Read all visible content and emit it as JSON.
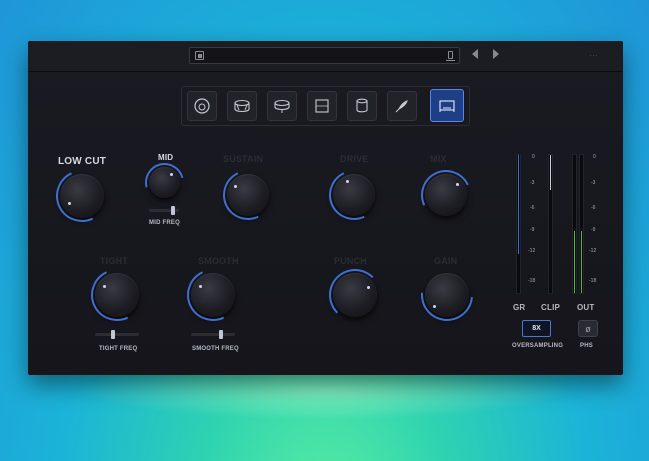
{
  "preset_bar": {
    "preset_name": "",
    "prev_label": "◀",
    "next_label": "▶",
    "menu_label": "···"
  },
  "toolbar": {
    "modes": [
      {
        "icon": "kick-drum-icon",
        "active": false
      },
      {
        "icon": "snare-drum-icon",
        "active": false
      },
      {
        "icon": "tom-drum-icon",
        "active": false
      },
      {
        "icon": "frame-icon",
        "active": false
      },
      {
        "icon": "hand-drum-icon",
        "active": false
      },
      {
        "icon": "feather-icon",
        "active": false
      },
      {
        "icon": "drum-overhead-icon",
        "active": true
      }
    ]
  },
  "controls": {
    "low_cut": "LOW CUT",
    "mid": "MID",
    "mid_freq": "MID FREQ",
    "faded_1": "SUSTAIN",
    "faded_2": "DRIVE",
    "faded_3": "MIX",
    "faded_4": "TIGHT",
    "faded_5": "SMOOTH",
    "faded_6": "PUNCH",
    "faded_7": "GAIN",
    "tight_freq": "TIGHT FREQ",
    "smooth_freq": "SMOOTH FREQ"
  },
  "meters": {
    "scale": [
      "0",
      "-3",
      "-6",
      "-9",
      "-12",
      "-18"
    ],
    "gr_label": "GR",
    "clip_label": "CLIP",
    "out_label": "OUT",
    "gr_level": 0.72,
    "clip_level": 0.25,
    "out_level": 0.45
  },
  "footer": {
    "oversampling_value": "8X",
    "oversampling_label": "OVERSAMPLING",
    "phase_icon": "ø",
    "phase_label": "PHS"
  },
  "colors": {
    "accent": "#3f6fd0",
    "meter_green": "#4cc03a",
    "meter_blue": "#3b6fe0"
  }
}
